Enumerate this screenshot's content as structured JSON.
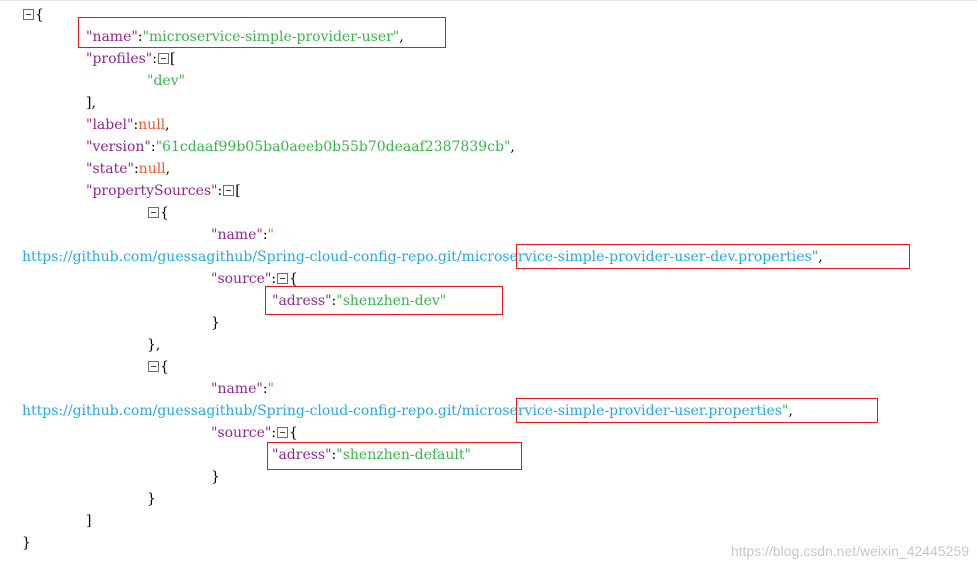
{
  "json": {
    "name_key": "\"name\"",
    "name_value": "\"microservice-simple-provider-user\"",
    "profiles_key": "\"profiles\"",
    "profile_0": "\"dev\"",
    "label_key": "\"label\"",
    "label_value": "null",
    "version_key": "\"version\"",
    "version_value": "\"61cdaaf99b05ba0aeeb0b55b70deaaf2387839cb\"",
    "state_key": "\"state\"",
    "state_value": "null",
    "propertySources_key": "\"propertySources\"",
    "sources": [
      {
        "name_key": "\"name\"",
        "name_open_quote": "\"",
        "url_prefix": "https://github.com/guessagithub/Spring-cloud-config-repo.git/",
        "file": "microservice-simple-provider-user-dev.properties",
        "close_quote": "\"",
        "source_key": "\"source\"",
        "adress_key": "\"adress\"",
        "adress_value": "\"shenzhen-dev\""
      },
      {
        "name_key": "\"name\"",
        "name_open_quote": "\"",
        "url_prefix": "https://github.com/guessagithub/Spring-cloud-config-repo.git/",
        "file": "microservice-simple-provider-user.properties",
        "close_quote": "\"",
        "source_key": "\"source\"",
        "adress_key": "\"adress\"",
        "adress_value": "\"shenzhen-default\""
      }
    ]
  },
  "watermark": "https://blog.csdn.net/weixin_42445259",
  "colors": {
    "key": "#92278f",
    "string": "#3ab54a",
    "url": "#25aae1",
    "null": "#f1592a",
    "highlight_box": "#e21a1a"
  },
  "icons": {
    "collapse_toggle": "collapse-toggle-icon"
  }
}
